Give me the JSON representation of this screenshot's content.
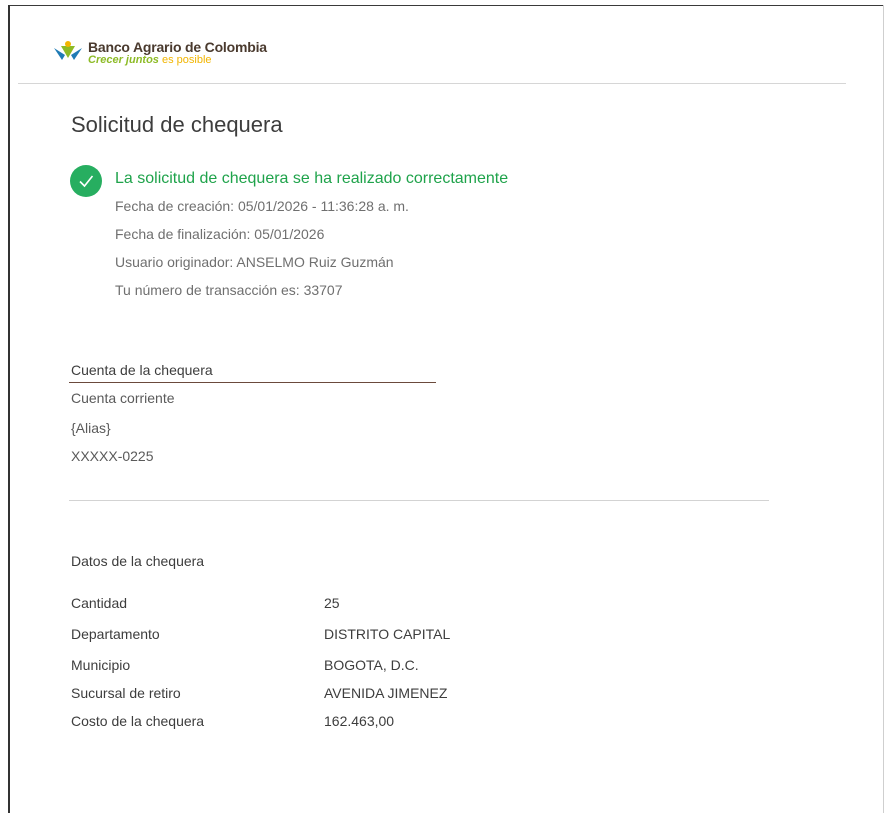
{
  "brand": {
    "name": "Banco Agrario de Colombia",
    "tagline_part1": "Crecer juntos",
    "tagline_part2": "es posible"
  },
  "page": {
    "title": "Solicitud de chequera"
  },
  "confirmation": {
    "message": "La solicitud de chequera se ha realizado correctamente",
    "creation_date": "Fecha de creación: 05/01/2026 - 11:36:28 a. m.",
    "end_date": "Fecha de finalización: 05/01/2026",
    "originator": "Usuario originador: ANSELMO  Ruiz Guzmán",
    "transaction": "Tu número de transacción es: 33707"
  },
  "account": {
    "section_title": "Cuenta de la chequera",
    "type": "Cuenta corriente",
    "alias": "{Alias}",
    "number": "XXXXX-0225"
  },
  "details": {
    "section_title": "Datos de la chequera",
    "rows": [
      {
        "label": "Cantidad",
        "value": "25"
      },
      {
        "label": "Departamento",
        "value": "DISTRITO CAPITAL"
      },
      {
        "label": "Municipio",
        "value": "BOGOTA, D.C."
      },
      {
        "label": "Sucursal de retiro",
        "value": "AVENIDA JIMENEZ"
      },
      {
        "label": "Costo de la chequera",
        "value": "162.463,00"
      }
    ]
  },
  "colors": {
    "success": "#27ae60",
    "brand_green": "#8dbb26",
    "brand_yellow": "#f2b500",
    "brand_brown": "#4a3a2e"
  }
}
